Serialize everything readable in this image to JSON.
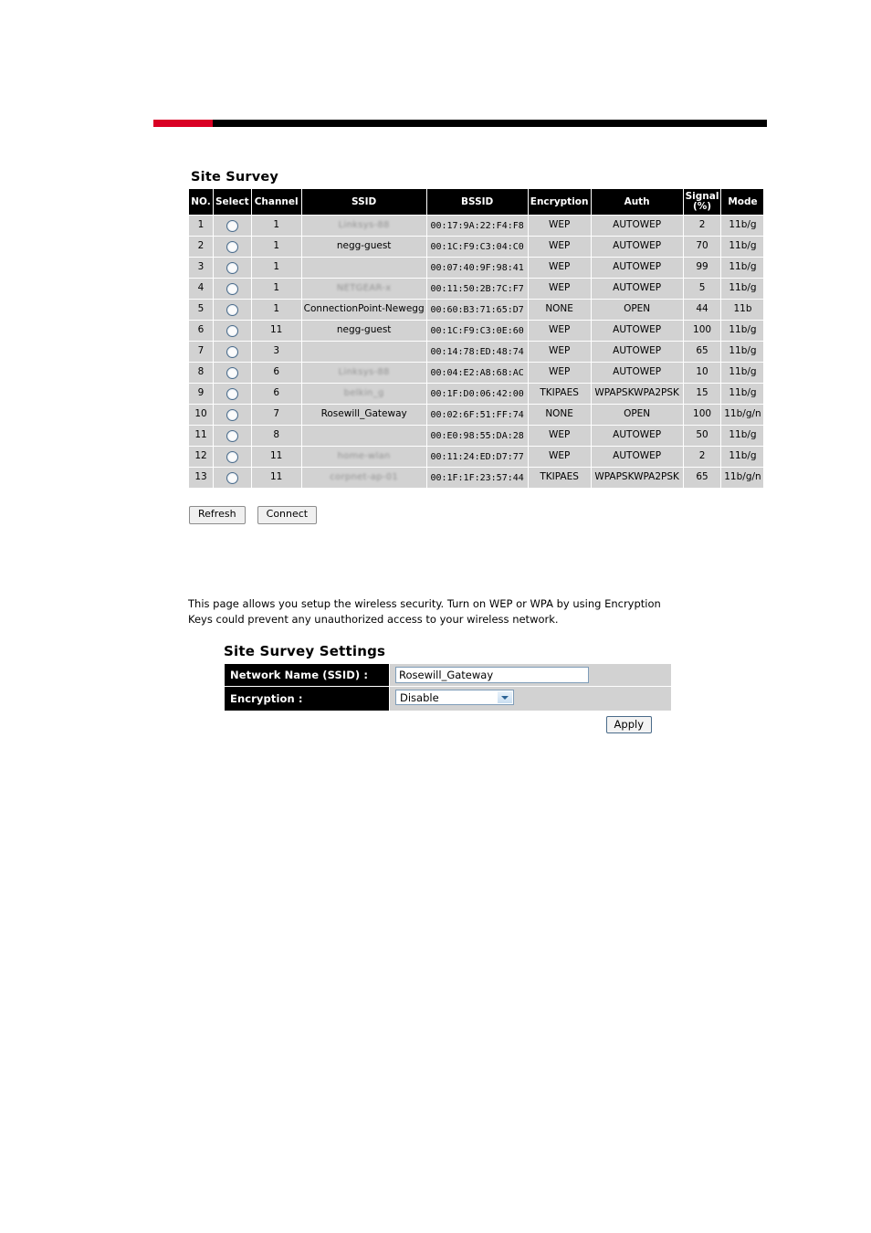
{
  "topbar": {
    "accent_color": "#d90024",
    "bar_color": "#000000"
  },
  "survey": {
    "title": "Site Survey",
    "columns": [
      "NO.",
      "Select",
      "Channel",
      "SSID",
      "BSSID",
      "Encryption",
      "Auth",
      "Signal\n(%)",
      "Mode"
    ],
    "column_labels": {
      "no": "NO.",
      "select": "Select",
      "channel": "Channel",
      "ssid": "SSID",
      "bssid": "BSSID",
      "encryption": "Encryption",
      "auth": "Auth",
      "signal_line1": "Signal",
      "signal_line2": "(%)",
      "mode": "Mode"
    },
    "rows": [
      {
        "no": "1",
        "channel": "1",
        "ssid": "",
        "ssid_redacted": true,
        "bssid": "00:17:9A:22:F4:F8",
        "encryption": "WEP",
        "auth": "AUTOWEP",
        "signal": "2",
        "mode": "11b/g"
      },
      {
        "no": "2",
        "channel": "1",
        "ssid": "negg-guest",
        "ssid_redacted": false,
        "bssid": "00:1C:F9:C3:04:C0",
        "encryption": "WEP",
        "auth": "AUTOWEP",
        "signal": "70",
        "mode": "11b/g"
      },
      {
        "no": "3",
        "channel": "1",
        "ssid": "",
        "ssid_redacted": false,
        "bssid": "00:07:40:9F:98:41",
        "encryption": "WEP",
        "auth": "AUTOWEP",
        "signal": "99",
        "mode": "11b/g"
      },
      {
        "no": "4",
        "channel": "1",
        "ssid": "",
        "ssid_redacted": true,
        "bssid": "00:11:50:2B:7C:F7",
        "encryption": "WEP",
        "auth": "AUTOWEP",
        "signal": "5",
        "mode": "11b/g"
      },
      {
        "no": "5",
        "channel": "1",
        "ssid": "ConnectionPoint-Newegg",
        "ssid_redacted": false,
        "bssid": "00:60:B3:71:65:D7",
        "encryption": "NONE",
        "auth": "OPEN",
        "signal": "44",
        "mode": "11b"
      },
      {
        "no": "6",
        "channel": "11",
        "ssid": "negg-guest",
        "ssid_redacted": false,
        "bssid": "00:1C:F9:C3:0E:60",
        "encryption": "WEP",
        "auth": "AUTOWEP",
        "signal": "100",
        "mode": "11b/g"
      },
      {
        "no": "7",
        "channel": "3",
        "ssid": "",
        "ssid_redacted": false,
        "bssid": "00:14:78:ED:48:74",
        "encryption": "WEP",
        "auth": "AUTOWEP",
        "signal": "65",
        "mode": "11b/g"
      },
      {
        "no": "8",
        "channel": "6",
        "ssid": "",
        "ssid_redacted": true,
        "bssid": "00:04:E2:A8:68:AC",
        "encryption": "WEP",
        "auth": "AUTOWEP",
        "signal": "10",
        "mode": "11b/g"
      },
      {
        "no": "9",
        "channel": "6",
        "ssid": "",
        "ssid_redacted": true,
        "bssid": "00:1F:D0:06:42:00",
        "encryption": "TKIPAES",
        "auth": "WPAPSKWPA2PSK",
        "signal": "15",
        "mode": "11b/g"
      },
      {
        "no": "10",
        "channel": "7",
        "ssid": "Rosewill_Gateway",
        "ssid_redacted": false,
        "bssid": "00:02:6F:51:FF:74",
        "encryption": "NONE",
        "auth": "OPEN",
        "signal": "100",
        "mode": "11b/g/n"
      },
      {
        "no": "11",
        "channel": "8",
        "ssid": "",
        "ssid_redacted": false,
        "bssid": "00:E0:98:55:DA:28",
        "encryption": "WEP",
        "auth": "AUTOWEP",
        "signal": "50",
        "mode": "11b/g"
      },
      {
        "no": "12",
        "channel": "11",
        "ssid": "",
        "ssid_redacted": true,
        "bssid": "00:11:24:ED:D7:77",
        "encryption": "WEP",
        "auth": "AUTOWEP",
        "signal": "2",
        "mode": "11b/g"
      },
      {
        "no": "13",
        "channel": "11",
        "ssid": "",
        "ssid_redacted": true,
        "bssid": "00:1F:1F:23:57:44",
        "encryption": "TKIPAES",
        "auth": "WPAPSKWPA2PSK",
        "signal": "65",
        "mode": "11b/g/n"
      }
    ],
    "buttons": {
      "refresh": "Refresh",
      "connect": "Connect"
    }
  },
  "description": "This page allows you setup the wireless security. Turn on WEP or WPA by using Encryption Keys could prevent any unauthorized access to your wireless network.",
  "settings": {
    "title": "Site Survey Settings",
    "ssid_label": "Network Name (SSID) :",
    "ssid_value": "Rosewill_Gateway",
    "encryption_label": "Encryption :",
    "encryption_value": "Disable",
    "apply_label": "Apply"
  }
}
